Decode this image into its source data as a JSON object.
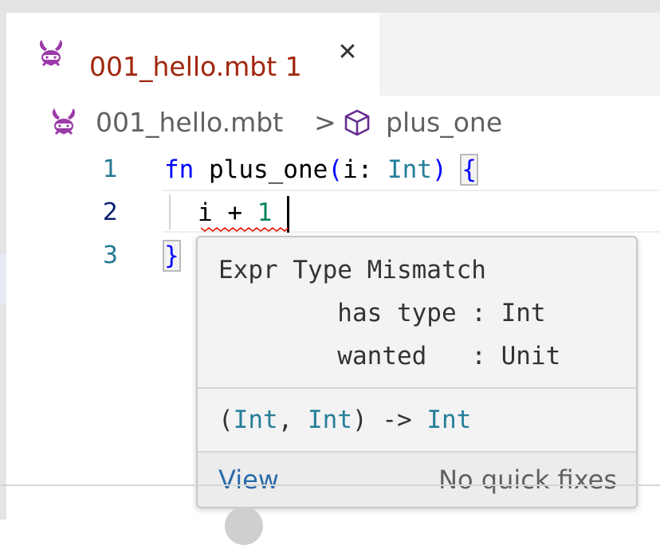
{
  "tab": {
    "title": "001_hello.mbt",
    "problem_count": "1",
    "close_glyph": "✕",
    "title_color": "#a1260d"
  },
  "breadcrumb": {
    "file": "001_hello.mbt",
    "separator": ">",
    "symbol": "plus_one",
    "file_icon": "moonbit-rabbit-icon",
    "symbol_icon": "symbol-cube-icon"
  },
  "editor": {
    "lines": [
      {
        "number": "1",
        "tokens": {
          "kw": "fn",
          "fname": " plus_one",
          "paren_open": "(",
          "param": "i: ",
          "type": "Int",
          "paren_close": ")",
          "space": " ",
          "brace": "{"
        }
      },
      {
        "number": "2",
        "tokens": {
          "expr": "i + ",
          "num": "1"
        }
      },
      {
        "number": "3",
        "tokens": {
          "brace": "}"
        }
      }
    ],
    "active_line": 2
  },
  "hover": {
    "message_lines": [
      "Expr Type Mismatch",
      "        has type : Int",
      "        wanted   : Unit"
    ],
    "signature": {
      "open": "(",
      "t1": "Int",
      "comma": ", ",
      "t2": "Int",
      "arrow": ") -> ",
      "ret": "Int"
    },
    "view_label": "View",
    "quick_fix_label": "No quick fixes"
  },
  "colors": {
    "keyword": "#0000ff",
    "type": "#267f99",
    "number": "#098658",
    "error_squiggle": "#e51400",
    "link": "#2a6aa8"
  }
}
